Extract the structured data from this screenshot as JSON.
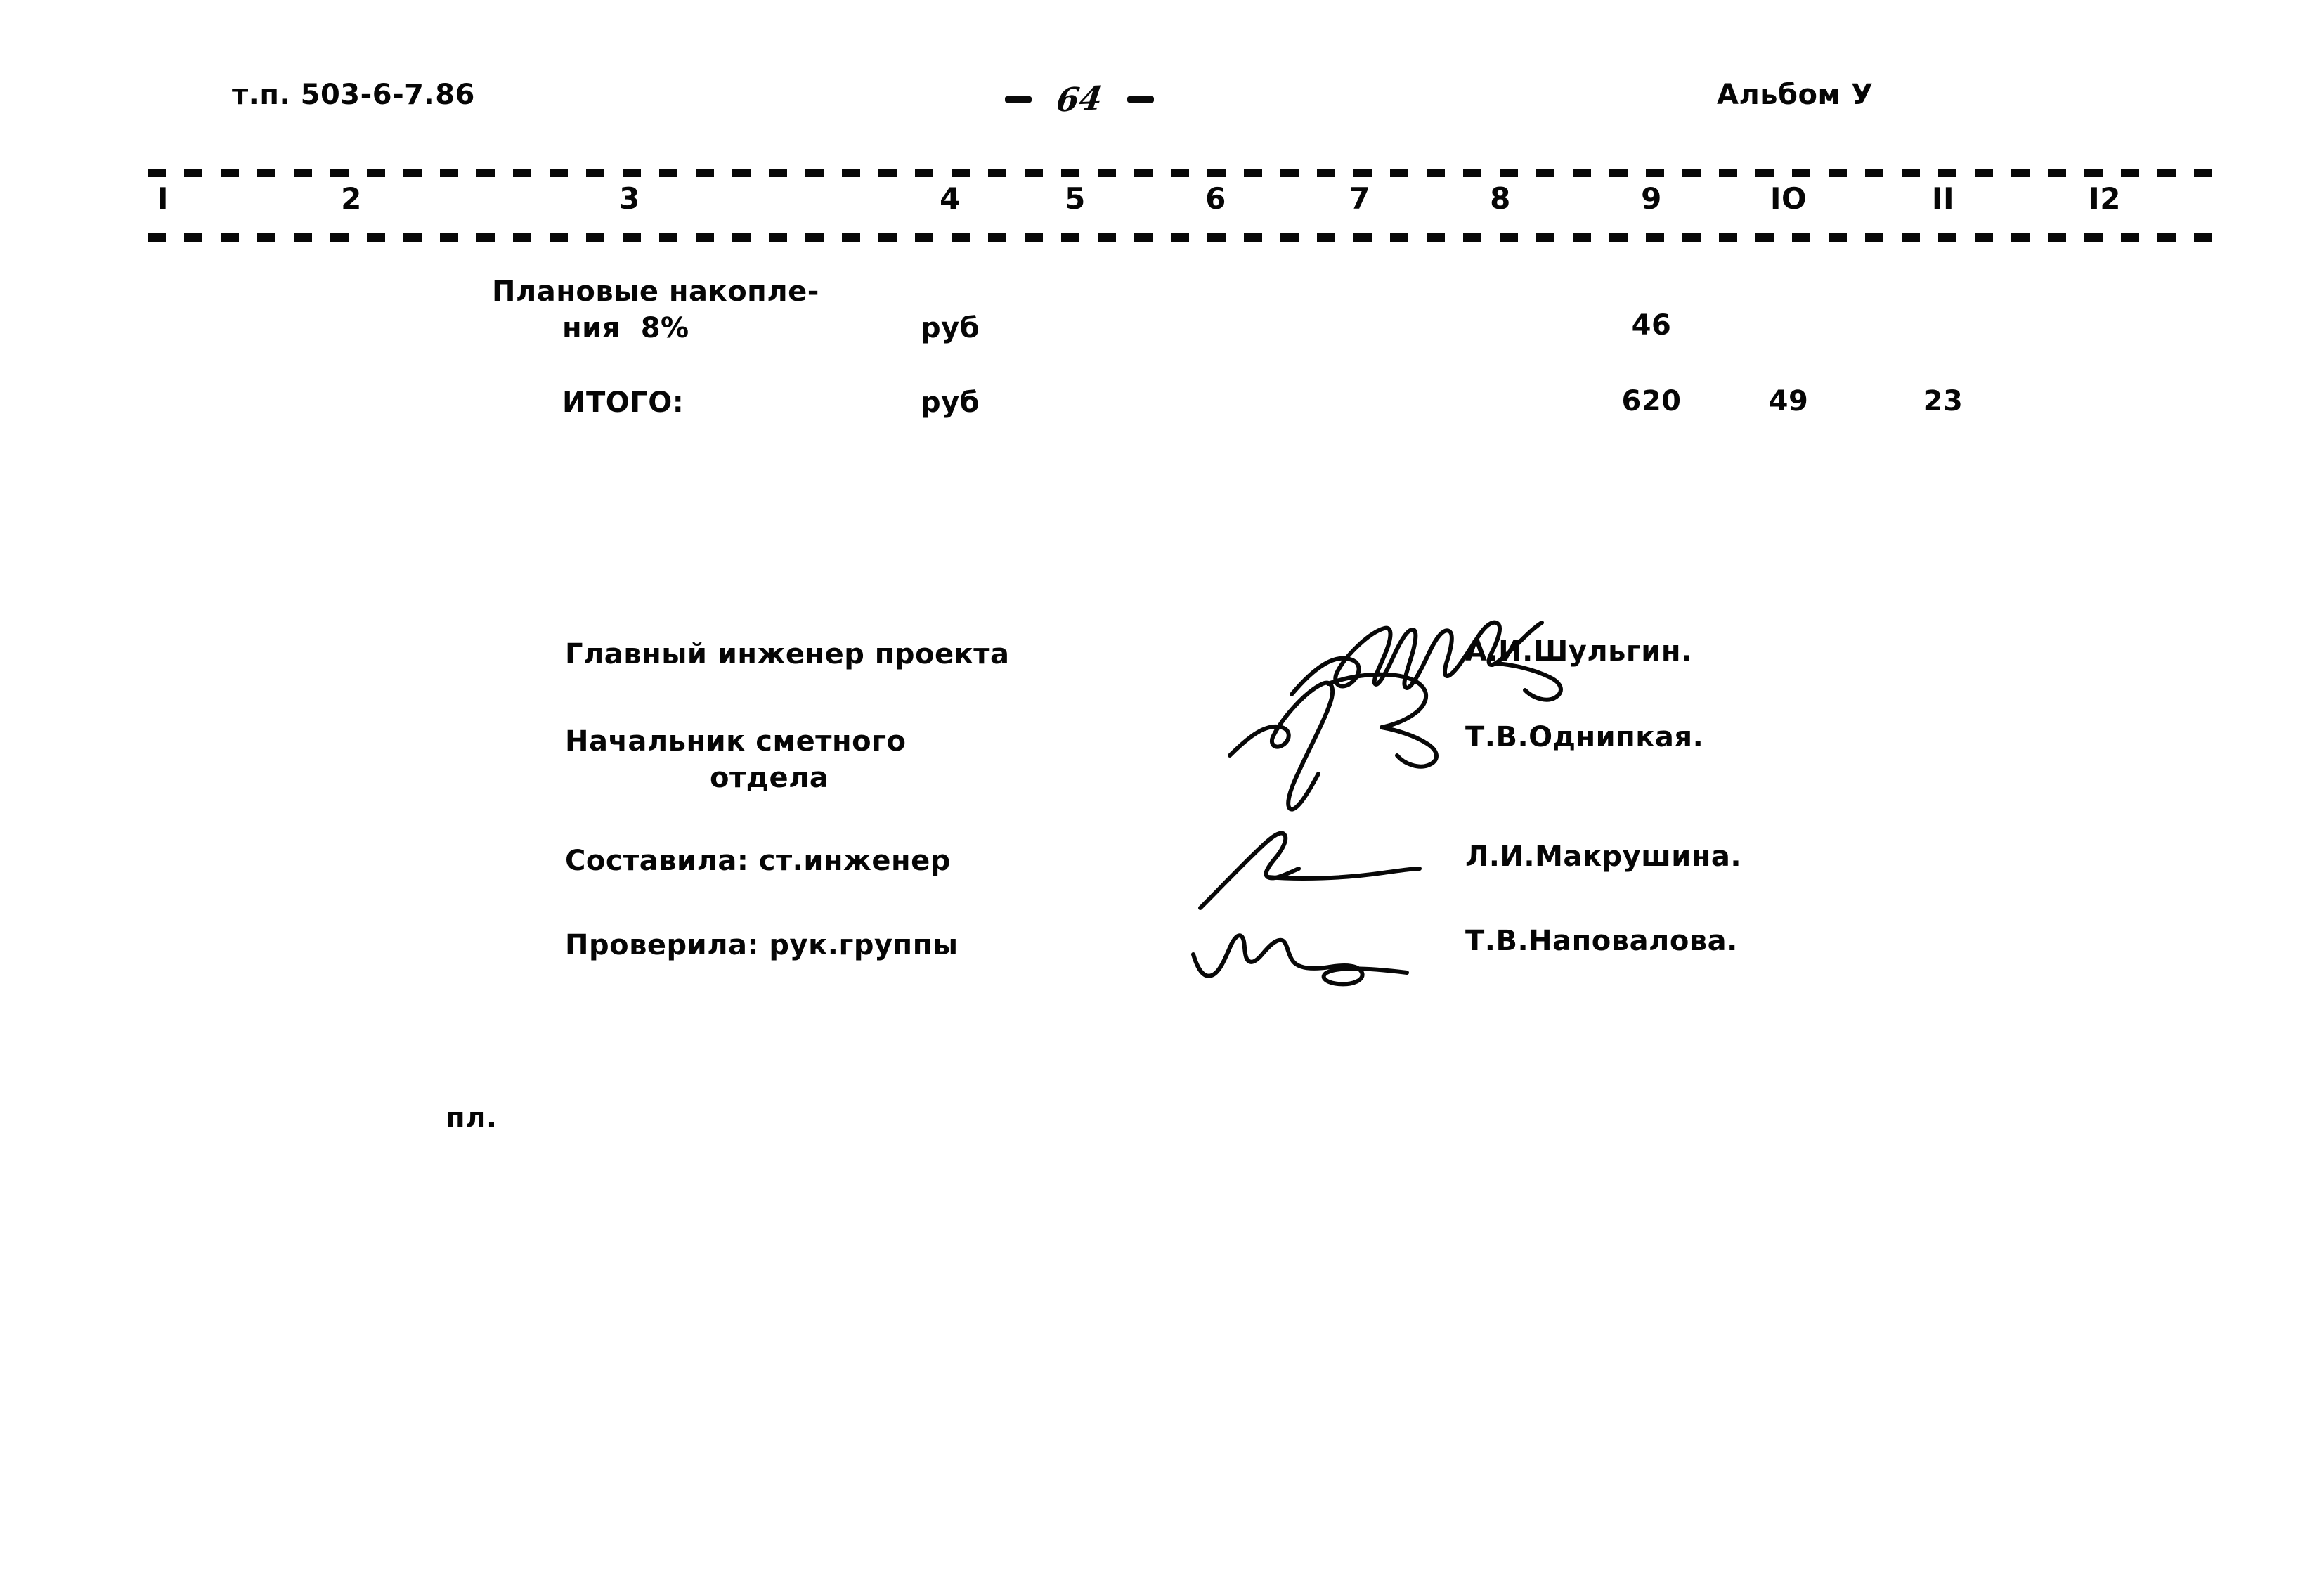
{
  "document": {
    "header": {
      "left_code": "т.п. 503-6-7.86",
      "page_number": "64",
      "page_dash_left": "-",
      "page_dash_right": "-",
      "album": "Альбом У"
    },
    "table": {
      "column_numbers": [
        "I",
        "2",
        "3",
        "4",
        "5",
        "6",
        "7",
        "8",
        "9",
        "IO",
        "II",
        "I2"
      ],
      "rows": [
        {
          "name_line1": "Плановые накопле-",
          "name_line2": "ния  8%",
          "unit": "руб",
          "col9": "46",
          "col10": "",
          "col11": ""
        },
        {
          "name_line1": "ИТОГО:",
          "name_line2": "",
          "unit": "руб",
          "col9": "620",
          "col10": "49",
          "col11": "23"
        }
      ]
    },
    "signatures": [
      {
        "role_line1": "Главный инженер проекта",
        "role_line2": "",
        "signature": "handwritten-signature",
        "name": "А.И.Шульгин."
      },
      {
        "role_line1": "Начальник сметного",
        "role_line2": "отдела",
        "signature": "handwritten-signature",
        "name": "Т.В.Однипкая."
      },
      {
        "role_line1": "Составила: ст.инженер",
        "role_line2": "",
        "signature": "handwritten-signature",
        "name": "Л.И.Макрушина."
      },
      {
        "role_line1": "Проверила: рук.группы",
        "role_line2": "",
        "signature": "handwritten-signature",
        "name": "Т.В.Наповалова."
      }
    ],
    "footer": {
      "mark": "пл."
    },
    "colors": {
      "ink": "#080808",
      "paper": "#ffffff"
    }
  }
}
